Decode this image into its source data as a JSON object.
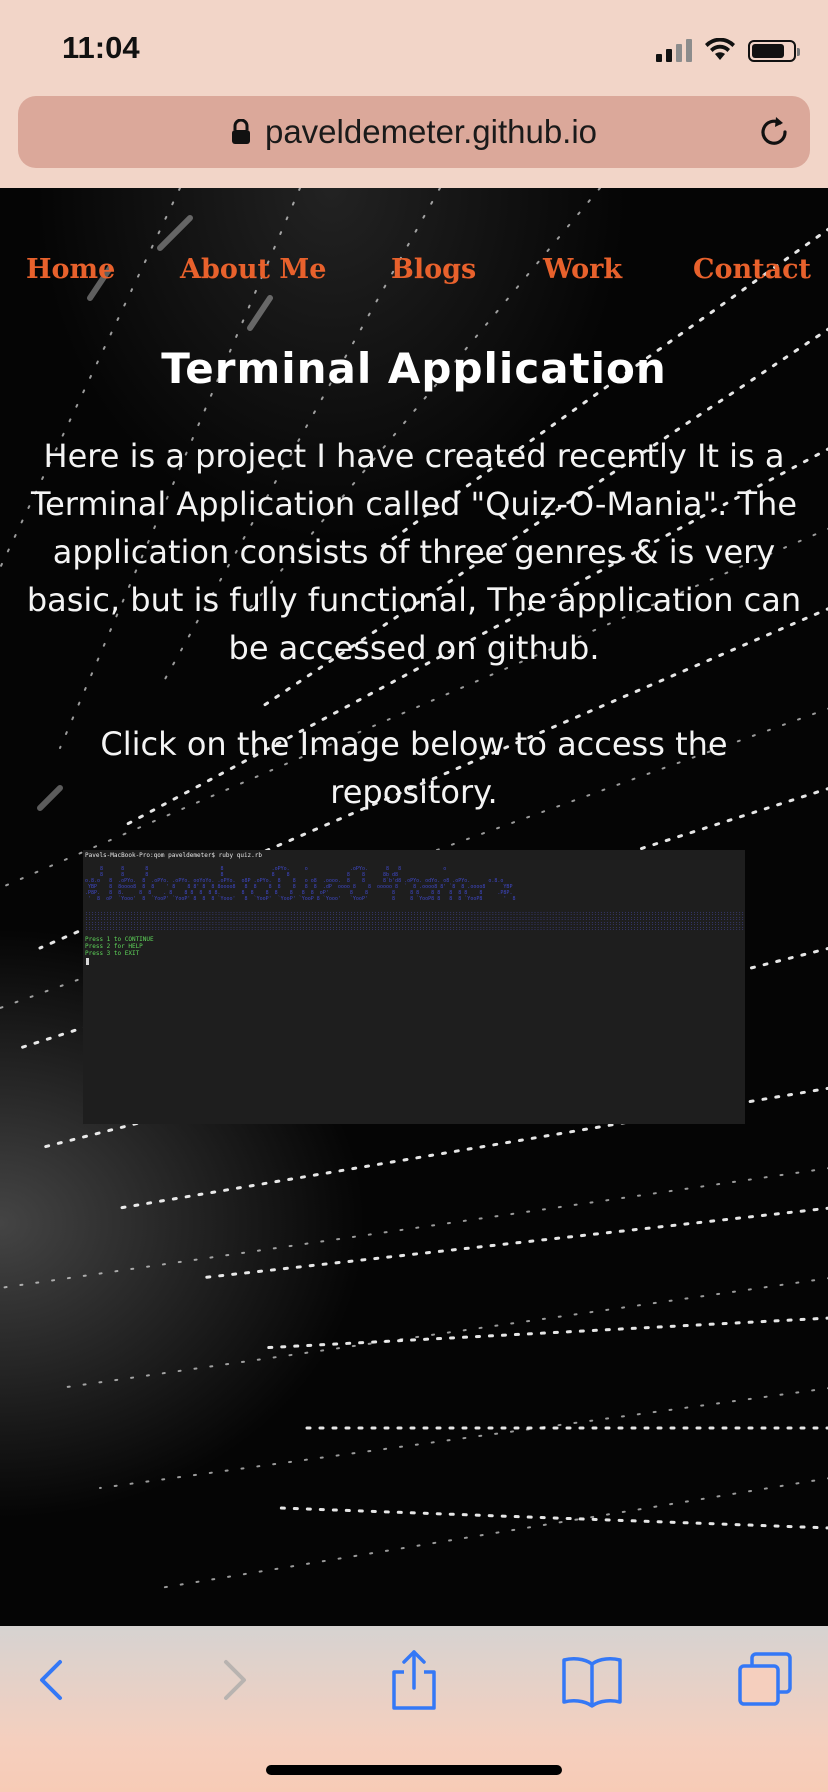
{
  "status_bar": {
    "time": "11:04"
  },
  "browser": {
    "url": "paveldemeter.github.io"
  },
  "nav": {
    "items": [
      {
        "label": "Home"
      },
      {
        "label": "About Me"
      },
      {
        "label": "Blogs"
      },
      {
        "label": "Work"
      },
      {
        "label": "Contact"
      }
    ]
  },
  "main": {
    "title": "Terminal Application",
    "paragraph1": "Here is a project I have created recently It is a Terminal Application called \"Quiz-O-Mania\". The application consists of three genres & is very basic, but is fully functional, The application can be accessed on github.",
    "paragraph2": "Click on the Image below to access the repository."
  },
  "terminal": {
    "prompt": "Pavels-MacBook-Pro:qom paveldemeter$ ruby quiz.rb",
    "menu": [
      "Press 1 to CONTINUE",
      "Press 2 for HELP",
      "Press 3 to EXIT"
    ]
  },
  "colors": {
    "nav": "#e8612c",
    "chrome": "#f2d5c8",
    "url_bar": "#dba89a",
    "toolbar_icons": "#3478f6"
  }
}
